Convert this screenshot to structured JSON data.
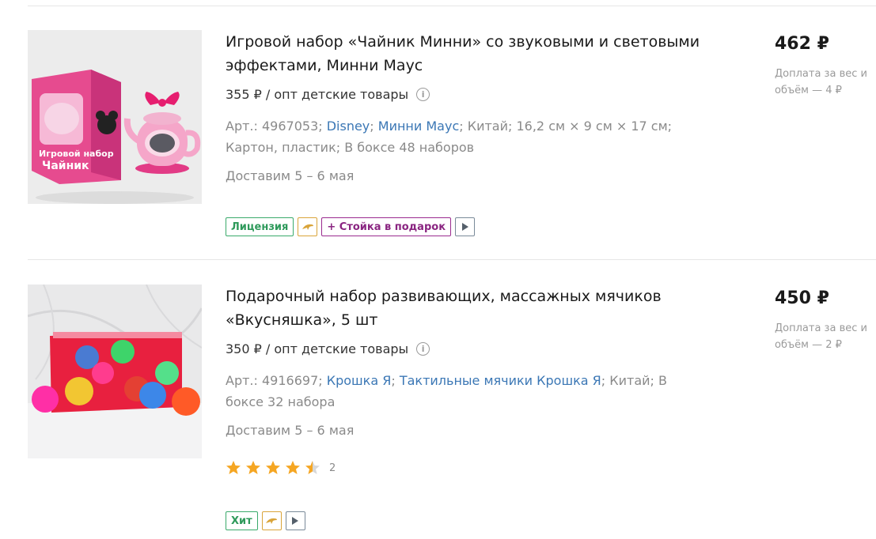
{
  "products": [
    {
      "title": "Игровой набор «Чайник Минни» со звуковыми и световыми эффектами, Минни Маус",
      "opt_price": "355 ₽ / опт детские товары",
      "meta": {
        "art": "Арт.: 4967053; ",
        "link1": "Disney",
        "sep": "; ",
        "link2": "Минни Маус",
        "rest": "; Китай; 16,2 см × 9 см × 17 см; Картон, пластик; В боксе 48 наборов"
      },
      "delivery": "Доставим 5 – 6 мая",
      "price": "462 ₽",
      "surcharge": "Доплата за вес и объём — 4 ₽",
      "badges": [
        "Лицензия",
        "+ Стойка в подарок"
      ]
    },
    {
      "title": "Подарочный набор развивающих, массажных мячиков «Вкусняшка», 5 шт",
      "opt_price": "350 ₽ / опт детские товары",
      "meta": {
        "art": "Арт.: 4916697; ",
        "link1": "Крошка Я",
        "sep": "; ",
        "link2": "Тактильные мячики Крошка Я",
        "rest": "; Китай; В боксе 32 набора"
      },
      "delivery": "Доставим 5 – 6 мая",
      "price": "450 ₽",
      "surcharge": "Доплата за вес и объём — 2 ₽",
      "rating": 4.5,
      "reviews": "2",
      "badges": [
        "Хит"
      ]
    }
  ]
}
